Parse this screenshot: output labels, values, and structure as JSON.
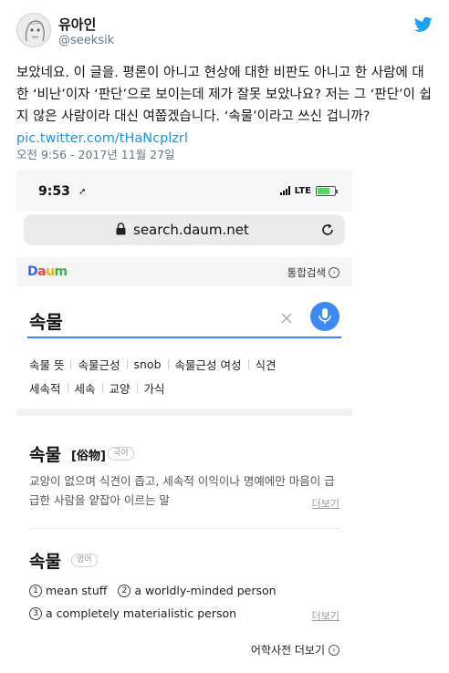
{
  "tweet": {
    "author_name": "유아인",
    "author_handle": "@seeksik",
    "text": "보았네요. 이 글을. 평론이 아니고 현상에 대한 비판도 아니고 한 사람에 대한 ‘비난’이자 ‘판단’으로 보이는데 제가 잘못 보았나요? 저는 그 ‘판단’이 쉽지 않은 사람이라 대신 여쭙겠습니다. ‘속물’이라고 쓰신 겁니까? ",
    "link": "pic.twitter.com/tHaNcplzrl",
    "timestamp": "오전 9:56 - 2017년 11월 27일",
    "brand_color": "#1da1f2",
    "link_color": "#1b95e0"
  },
  "phone": {
    "status_time": "9:53",
    "network": "LTE",
    "battery_level": 0.7,
    "url": "search.daum.net",
    "daum_logo": "Daum",
    "integrated_search": "통합검색",
    "search_query": "속물",
    "suggestions_row1": [
      "속물 뜻",
      "속물근성",
      "snob",
      "속물근성 여성",
      "식견"
    ],
    "suggestions_row2": [
      "세속적",
      "세속",
      "교양",
      "가식"
    ],
    "entry1": {
      "word": "속물",
      "hanja": "[俗物]",
      "tag": "국어",
      "definition": "교양이 없으며 식견이 좁고, 세속적 이익이나 명예에만 마음이 급급한 사람을 얕잡아 이르는 말",
      "more": "더보기"
    },
    "entry2": {
      "word": "속물",
      "tag": "영어",
      "meanings": [
        {
          "num": "1",
          "text": "mean stuff"
        },
        {
          "num": "2",
          "text": "a worldly-minded person"
        },
        {
          "num": "3",
          "text": "a completely materialistic person"
        }
      ],
      "more": "더보기"
    },
    "dictionary_more": "어학사전 더보기",
    "accent_color": "#3d8af7"
  }
}
